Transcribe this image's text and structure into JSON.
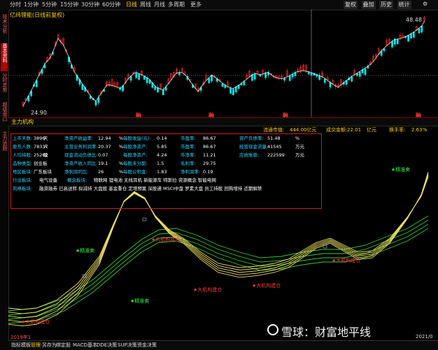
{
  "top_tabs": [
    "分时",
    "1分钟",
    "5分钟",
    "15分钟",
    "30分钟",
    "60分钟",
    "日线",
    "周线",
    "月线",
    "多周期",
    "更多"
  ],
  "top_active_tab": "日线",
  "right_buttons": [
    "复权",
    "叠加",
    "历史",
    "统计"
  ],
  "side_tabs": [
    "技术分析",
    "基本资料",
    "分时走势",
    "超级盘口",
    "主力追踪"
  ],
  "stock": {
    "title": "亿纬锂能(日线前复权)",
    "high_price": "48.48",
    "low_price": "24.90",
    "markers": [
      "融",
      "融",
      "融",
      "融"
    ]
  },
  "indicator": {
    "name": "主力机构",
    "info_items": [
      {
        "label": "流通市值:",
        "value": "444.00亿元",
        "color": "#ffd200"
      },
      {
        "label": "成交金额:",
        "value": "22.01",
        "color": "#ffd200"
      },
      {
        "label": "亿元",
        "value": "",
        "color": "#ffd200"
      },
      {
        "label": "换手率:",
        "value": "2.63",
        "color": "#ffd200"
      },
      {
        "label": "%",
        "value": "",
        "color": "#ffd200"
      }
    ],
    "fin_rows": [
      [
        {
          "label": "上市天数:",
          "value": "3896",
          "unit": "天"
        },
        {
          "label": "净资产收益率:",
          "value": "12.94",
          "unit": "%"
        },
        {
          "label": "每股收益(元):",
          "value": "0.14",
          "unit": ""
        },
        {
          "label": "市盈率:",
          "value": "86.67",
          "unit": ""
        },
        {
          "label": "资产负债率:",
          "value": "51.48",
          "unit": "%"
        }
      ],
      [
        {
          "label": "股东人数:",
          "value": "78337",
          "unit": "人"
        },
        {
          "label": "主营业务利润率:",
          "value": "20.37",
          "unit": "%"
        },
        {
          "label": "每股净资产:",
          "value": "5.85",
          "unit": ""
        },
        {
          "label": "市盈率:",
          "value": "86.67",
          "unit": ""
        },
        {
          "label": "经营现金流量:",
          "value": "41545",
          "unit": "万元"
        }
      ],
      [
        {
          "label": "人均持股:",
          "value": "25262",
          "unit": "股"
        },
        {
          "label": "现金流动负债比:",
          "value": "0.07",
          "unit": ""
        },
        {
          "label": "每股净资产:",
          "value": "4.24",
          "unit": ""
        },
        {
          "label": "市净率:",
          "value": "11.21",
          "unit": ""
        },
        {
          "label": "应收账款:",
          "value": "222599",
          "unit": "万元"
        }
      ],
      [
        {
          "label": "品种类型:",
          "value": "创业板",
          "unit": ""
        },
        {
          "label": "净资产收入同比:",
          "value": "19.1",
          "unit": "%"
        },
        {
          "label": "每股未分配:",
          "value": "1.5",
          "unit": ""
        },
        {
          "label": "毛利率:",
          "value": "29.75",
          "unit": ""
        }
      ],
      [
        {
          "label": "地区板块:",
          "value": "广东板块",
          "unit": ""
        },
        {
          "label": "净利润同比:",
          "value": "26",
          "unit": "%"
        },
        {
          "label": "每股公积金:",
          "value": "1.83",
          "unit": ""
        },
        {
          "label": "净利润率:",
          "value": "0.19",
          "unit": ""
        }
      ]
    ],
    "industry_label": "行业板块:",
    "industry_value": "电气设备",
    "concept_label": "概念板块:",
    "concepts": "物联网 锂电池 无线耳机 新能源车 特斯拉 资源概念 智能电网",
    "style_label": "风格板块:",
    "styles": "融资融券 已高送转 拟减持 大盘股 基金重仓 定增预案 深股通 MSCI中盘 罗素大盘 员工持股 回购增持 近期解禁",
    "annotations": [
      {
        "text": "★精准卖",
        "color": "green"
      },
      {
        "text": "★精准卖",
        "color": "green"
      },
      {
        "text": "★精准卖",
        "color": "green"
      },
      {
        "text": "★大机构建仓",
        "color": "red"
      },
      {
        "text": "★大机构建仓",
        "color": "red"
      },
      {
        "text": "★大机构建仓",
        "color": "red"
      },
      {
        "text": "★大机构建仓",
        "color": "red"
      },
      {
        "text": "★大机构建仓",
        "color": "red"
      }
    ]
  },
  "bottom_tabs": [
    "指标",
    "模板",
    "管理",
    "另存为",
    "绑定股",
    "MACD基本",
    "DDE决策",
    "SUP决策",
    "资金决策"
  ],
  "bottom_active_tab": "管理",
  "date_label": "2019年1",
  "date_right": "2021/0",
  "watermark": "雪球：财富地平线",
  "colors": {
    "up": "#ff2d2d",
    "down": "#00e5e5",
    "ma": "#ffffff",
    "yellow_band": "#f0e060",
    "green_band": "#2fd02f",
    "box": "#d21a1a",
    "label": "#25d5ff"
  }
}
